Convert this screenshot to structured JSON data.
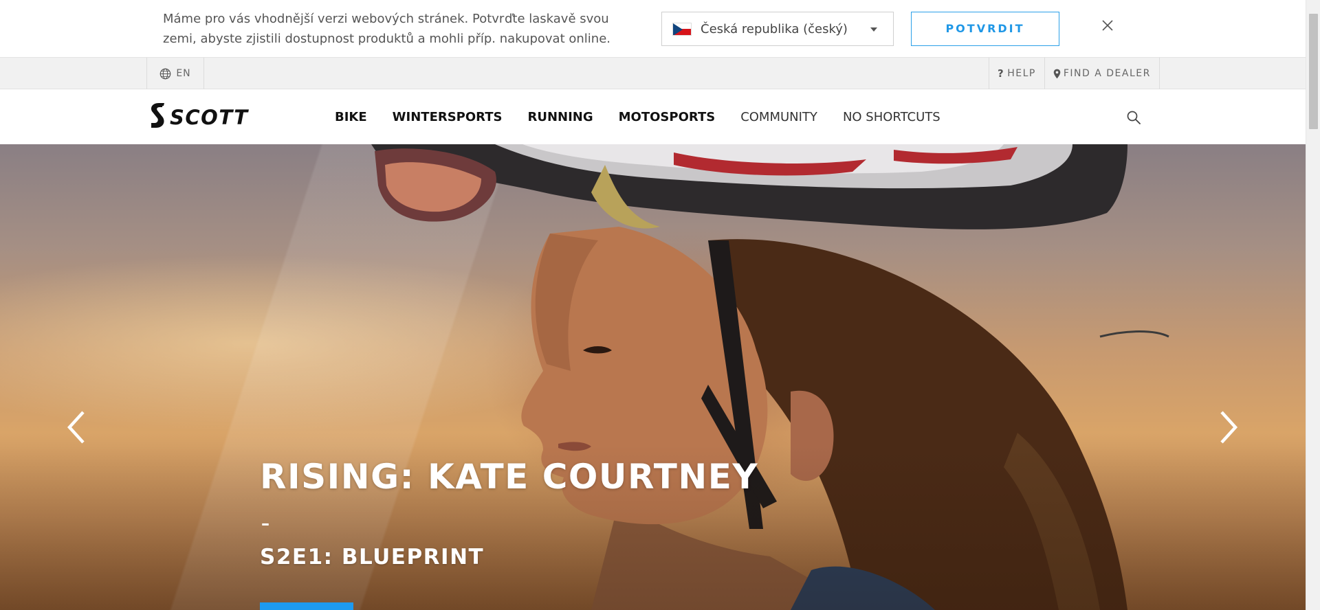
{
  "banner": {
    "message": "Máme pro vás vhodnější verzi webových stránek. Potvrďte laskavě svou zemi, abyste zjistili dostupnost produktů a mohli příp. nakupovat online.",
    "country_selected": "Česká republika (český)",
    "confirm_label": "POTVRDIT",
    "icons": {
      "flag": "czech-flag-icon",
      "caret": "caret-down-icon",
      "close": "close-icon"
    }
  },
  "utility": {
    "language": "EN",
    "help": "HELP",
    "find_dealer": "FIND A DEALER"
  },
  "nav": {
    "brand": "SCOTT",
    "items": [
      {
        "label": "BIKE"
      },
      {
        "label": "WINTERSPORTS"
      },
      {
        "label": "RUNNING"
      },
      {
        "label": "MOTOSPORTS"
      },
      {
        "label": "COMMUNITY"
      },
      {
        "label": "NO SHORTCUTS"
      }
    ]
  },
  "hero": {
    "title": "RISING: KATE COURTNEY",
    "dash": "–",
    "subtitle": "S2E1: BLUEPRINT"
  },
  "colors": {
    "accent": "#1f97e6",
    "cta": "#1d9af0",
    "utility_bg": "#f1f1f1"
  }
}
